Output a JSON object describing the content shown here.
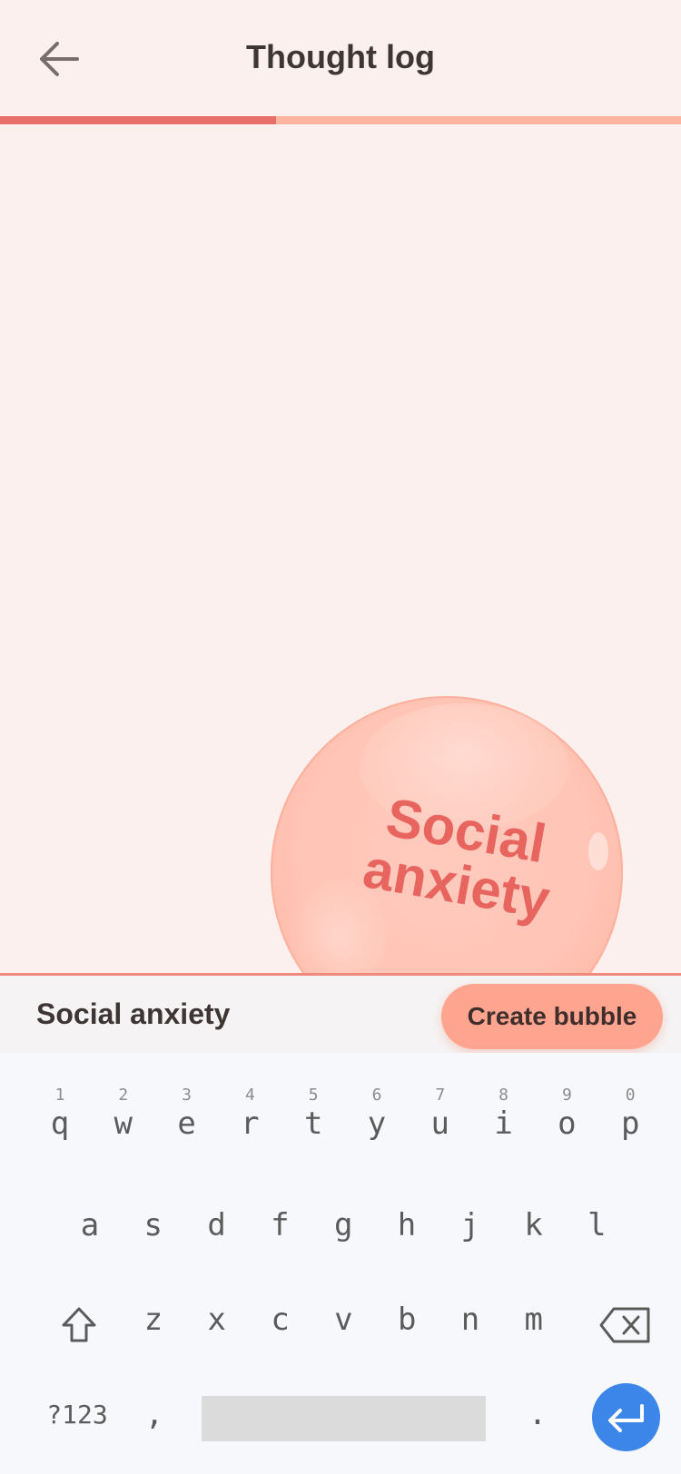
{
  "header": {
    "title": "Thought log",
    "back_icon": "arrow-left-icon"
  },
  "progress": {
    "value": 0.405,
    "fill_color": "#e8706a",
    "track_color": "#ffb3a0"
  },
  "bubble": {
    "label_line1": "Social",
    "label_line2": "anxiety",
    "label_color": "#e8645e"
  },
  "input": {
    "value": "Social anxiety",
    "create_button_label": "Create bubble"
  },
  "keyboard": {
    "row1": [
      {
        "key": "q",
        "hint": "1"
      },
      {
        "key": "w",
        "hint": "2"
      },
      {
        "key": "e",
        "hint": "3"
      },
      {
        "key": "r",
        "hint": "4"
      },
      {
        "key": "t",
        "hint": "5"
      },
      {
        "key": "y",
        "hint": "6"
      },
      {
        "key": "u",
        "hint": "7"
      },
      {
        "key": "i",
        "hint": "8"
      },
      {
        "key": "o",
        "hint": "9"
      },
      {
        "key": "p",
        "hint": "0"
      }
    ],
    "row2": [
      "a",
      "s",
      "d",
      "f",
      "g",
      "h",
      "j",
      "k",
      "l"
    ],
    "row3": [
      "z",
      "x",
      "c",
      "v",
      "b",
      "n",
      "m"
    ],
    "symbols_label": "?123",
    "comma_label": ",",
    "period_label": ".",
    "enter_color": "#3c86ea"
  }
}
